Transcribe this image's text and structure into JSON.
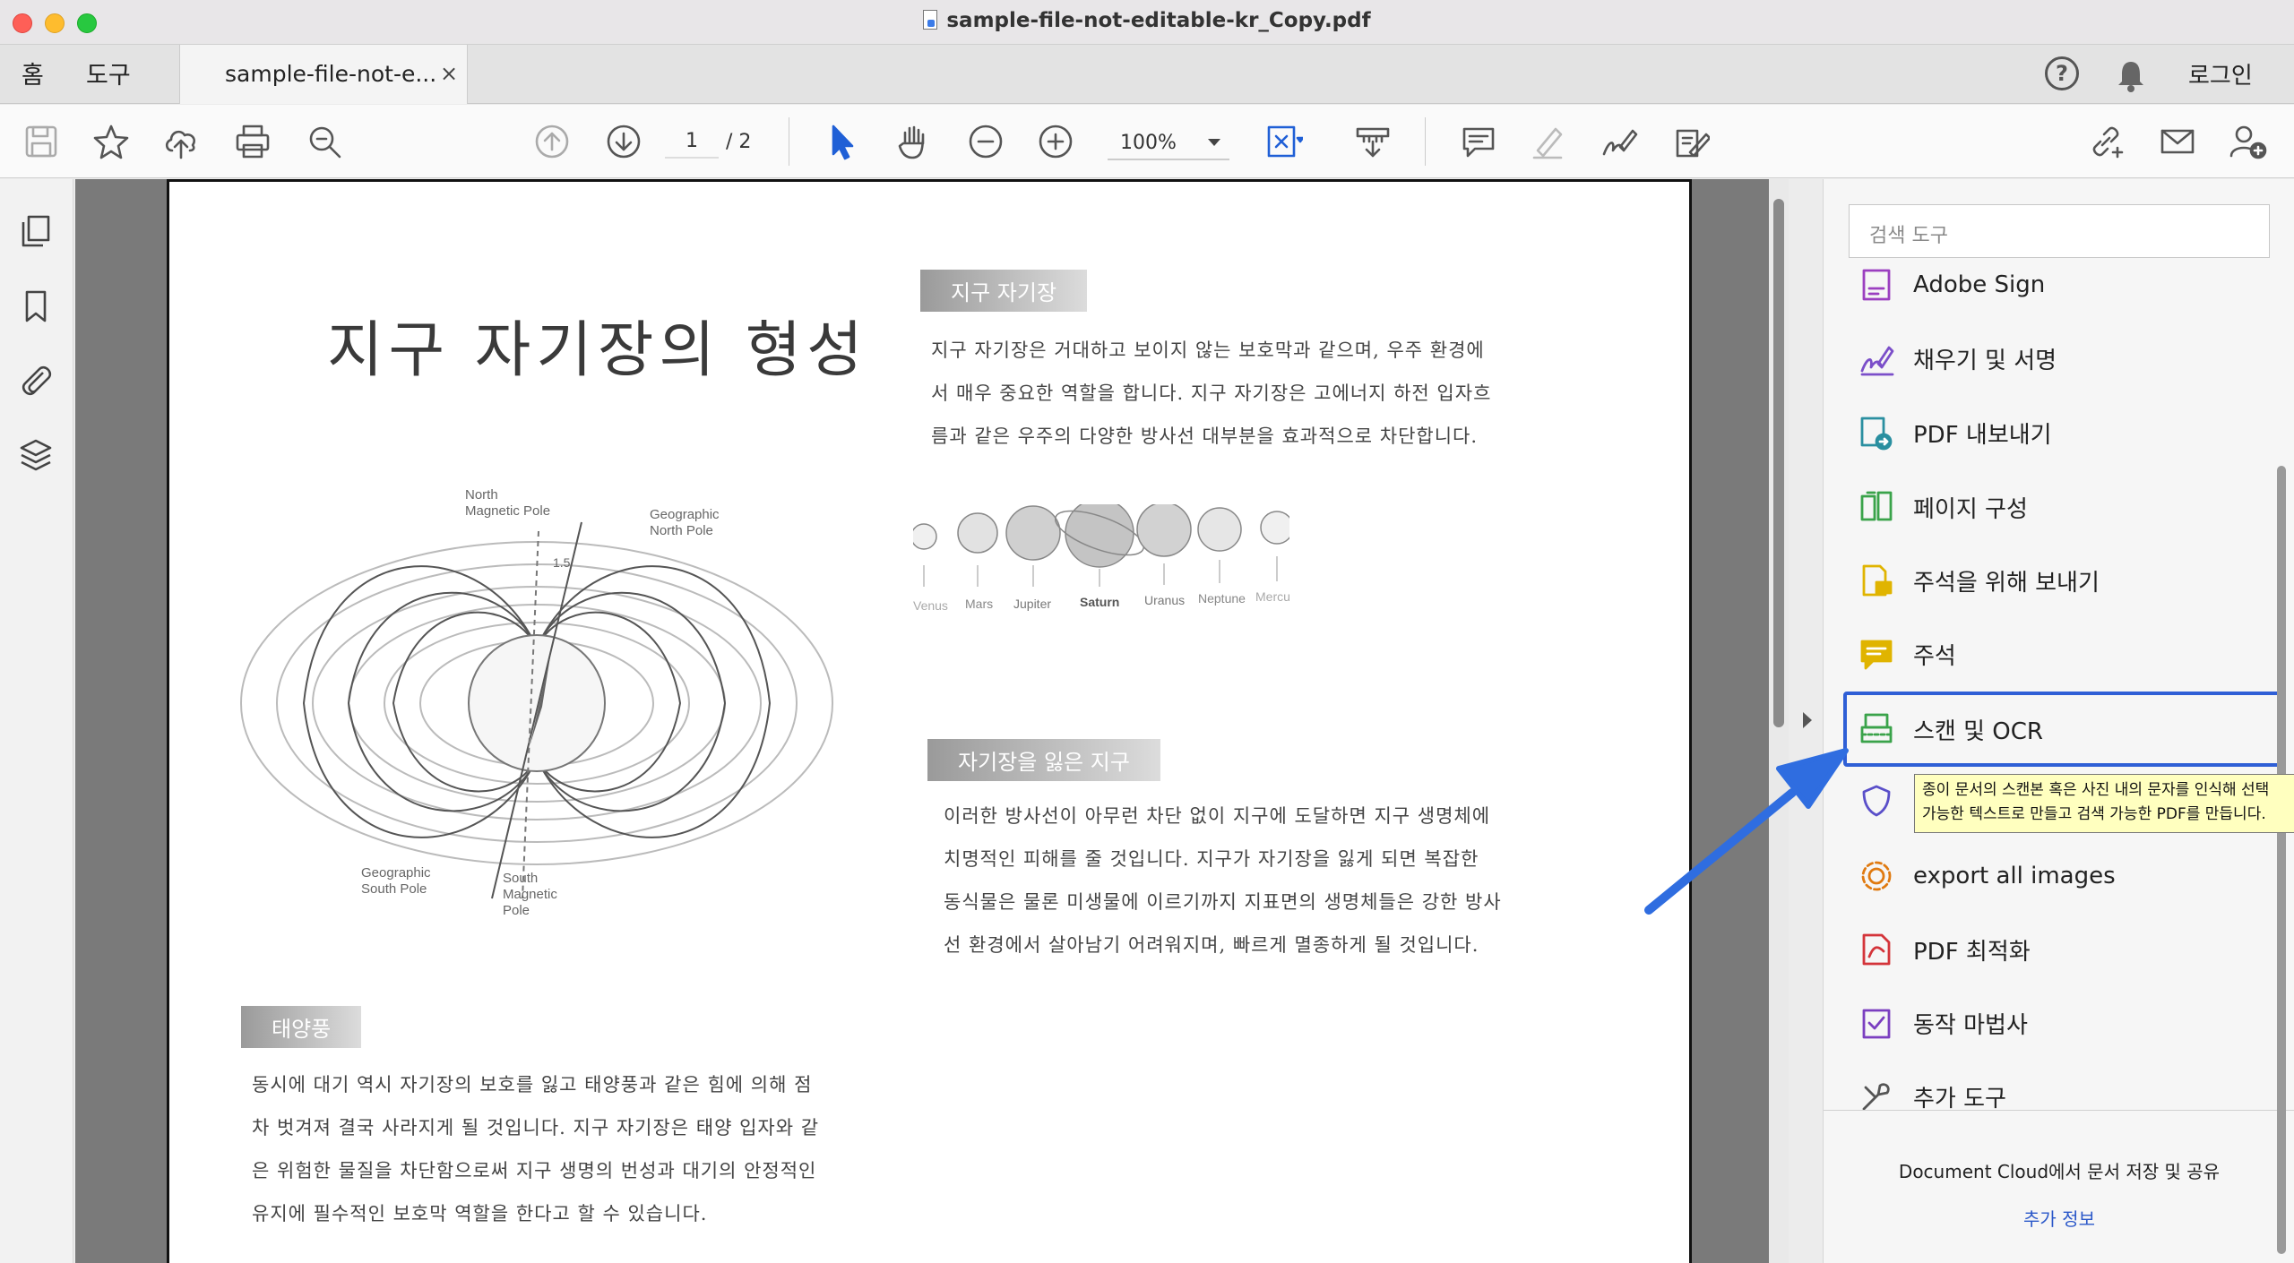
{
  "window": {
    "title": "sample-file-not-editable-kr_Copy.pdf"
  },
  "tabs": {
    "home": "홈",
    "tools": "도구",
    "document": "sample-file-not-e...",
    "close": "×"
  },
  "header": {
    "help": "?",
    "login": "로그인"
  },
  "toolbar": {
    "icons": [
      "save-icon",
      "star-icon",
      "upload-cloud-icon",
      "print-icon",
      "zoom-search-icon",
      "page-up-icon",
      "page-down-icon",
      "select-arrow-icon",
      "hand-icon",
      "zoom-out-icon",
      "zoom-in-icon",
      "fit-page-icon",
      "read-mode-icon",
      "comment-icon",
      "highlight-icon",
      "sign-icon",
      "edit-pdf-icon",
      "share-link-icon",
      "email-icon",
      "add-user-icon"
    ],
    "page_current": "1",
    "page_total": "/ 2",
    "zoom": "100%"
  },
  "document": {
    "title": "지구 자기장의 형성",
    "section1": {
      "label": "지구 자기장",
      "body": [
        "지구 자기장은 거대하고 보이지 않는 보호막과 같으며, 우주 환경에",
        "서 매우 중요한 역할을 합니다. 지구 자기장은 고에너지 하전 입자흐",
        "름과 같은 우주의 다양한 방사선 대부분을 효과적으로 차단합니다."
      ]
    },
    "planets": [
      "Venus",
      "Mars",
      "Jupiter",
      "Saturn",
      "Uranus",
      "Neptune",
      "Mercury"
    ],
    "diagram_labels": {
      "north_magnetic": [
        "North",
        "Magnetic Pole"
      ],
      "geo_north": [
        "Geographic",
        "North Pole"
      ],
      "geo_south": [
        "Geographic",
        "South Pole"
      ],
      "south_magnetic": [
        "South",
        "Magnetic",
        "Pole"
      ],
      "angle": "1.5"
    },
    "section2": {
      "label": "자기장을 잃은 지구",
      "body": [
        "이러한 방사선이 아무런 차단 없이 지구에 도달하면 지구 생명체에",
        "치명적인 피해를 줄 것입니다. 지구가 자기장을 잃게 되면 복잡한",
        "동식물은 물론 미생물에 이르기까지 지표면의 생명체들은 강한 방사",
        "선 환경에서 살아남기 어려워지며, 빠르게 멸종하게 될 것입니다."
      ]
    },
    "section3": {
      "label": "태양풍",
      "body": [
        "동시에 대기 역시 자기장의 보호를 잃고 태양풍과 같은 힘에 의해 점",
        "차 벗겨져 결국 사라지게 될 것입니다. 지구 자기장은 태양 입자와 같",
        "은 위험한 물질을 차단함으로써 지구 생명의 번성과 대기의 안정적인",
        "유지에 필수적인 보호막 역할을 한다고 할 수 있습니다."
      ]
    }
  },
  "right_panel": {
    "search_placeholder": "검색 도구",
    "tools": [
      {
        "label": "Adobe Sign",
        "icon": "adobe-sign-icon",
        "color": "#9b3fc0"
      },
      {
        "label": "채우기 및 서명",
        "icon": "fill-sign-icon",
        "color": "#7b4fc9"
      },
      {
        "label": "PDF 내보내기",
        "icon": "export-pdf-icon",
        "color": "#2a8fa0"
      },
      {
        "label": "페이지 구성",
        "icon": "organize-pages-icon",
        "color": "#3aa34a"
      },
      {
        "label": "주석을 위해 보내기",
        "icon": "send-comment-icon",
        "color": "#e0b400"
      },
      {
        "label": "주석",
        "icon": "comment-tool-icon",
        "color": "#e0b400"
      },
      {
        "label": "스캔 및 OCR",
        "icon": "scan-ocr-icon",
        "color": "#3aa34a"
      },
      {
        "label": "보호",
        "icon": "protect-icon",
        "color": "#5a4fc9"
      },
      {
        "label": "export all images",
        "icon": "gear-export-icon",
        "color": "#e07a10"
      },
      {
        "label": "PDF 최적화",
        "icon": "optimize-pdf-icon",
        "color": "#d4343a"
      },
      {
        "label": "동작 마법사",
        "icon": "action-wizard-icon",
        "color": "#7b3fc0"
      },
      {
        "label": "추가 도구",
        "icon": "more-tools-icon",
        "color": "#555555"
      }
    ],
    "tooltip": [
      "종이 문서의 스캔본 혹은 사진 내의 문자를 인식해 선택",
      "가능한 텍스트로 만들고 검색 가능한 PDF를 만듭니다."
    ],
    "cloud_text": "Document Cloud에서 문서 저장 및 공유",
    "more_info": "추가 정보"
  },
  "colors": {
    "accent": "#2f5fd6",
    "arrow": "#2f6de0"
  }
}
